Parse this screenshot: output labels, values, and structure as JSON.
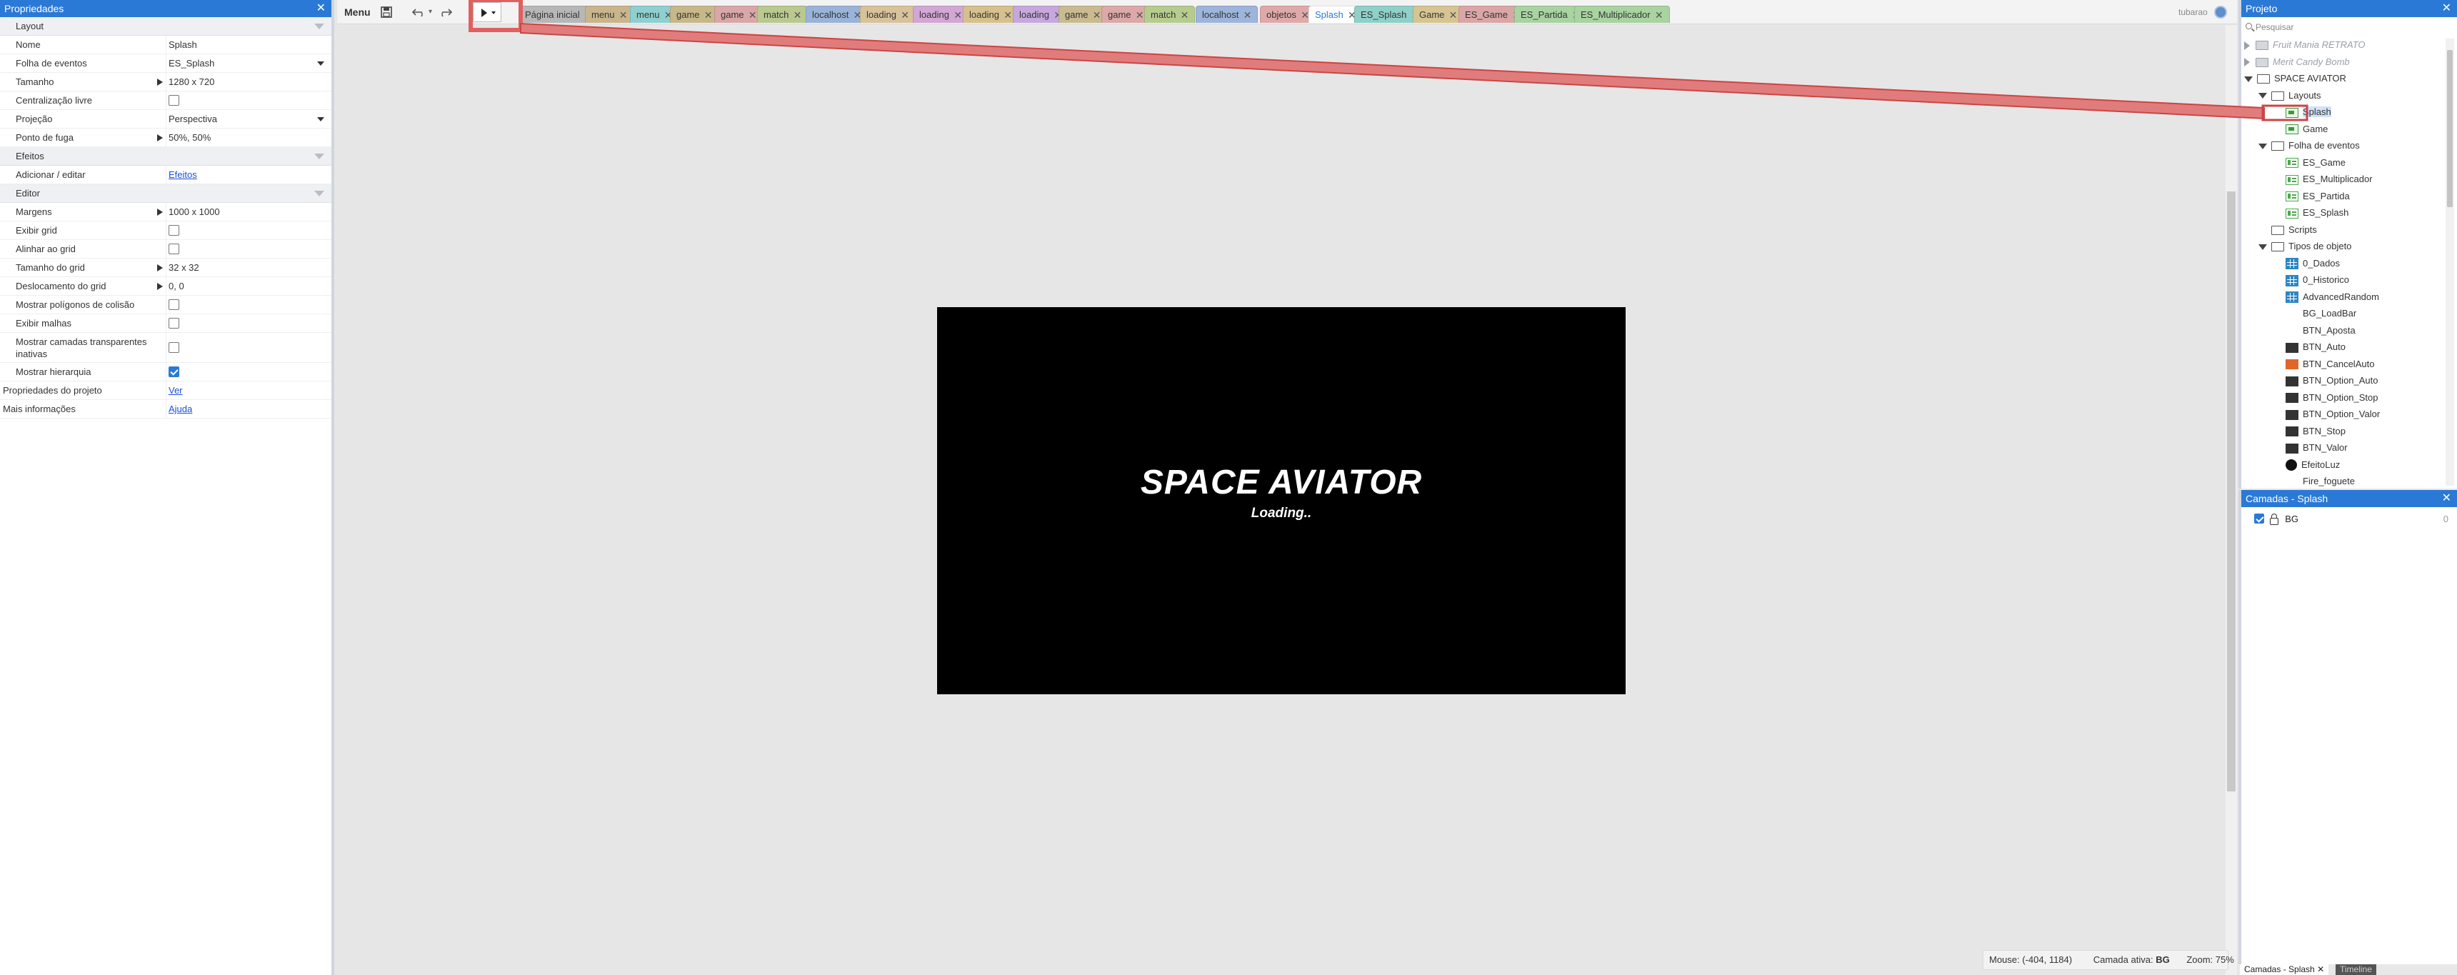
{
  "properties_panel": {
    "title": "Propriedades",
    "sections": {
      "layout": "Layout",
      "efeitos": "Efeitos",
      "editor": "Editor"
    },
    "rows": {
      "nome": {
        "label": "Nome",
        "value": "Splash"
      },
      "folha": {
        "label": "Folha de eventos",
        "value": "ES_Splash"
      },
      "tamanho": {
        "label": "Tamanho",
        "value": "1280 x 720"
      },
      "centralizacao": {
        "label": "Centralização livre",
        "checked": false
      },
      "projecao": {
        "label": "Projeção",
        "value": "Perspectiva"
      },
      "ponto": {
        "label": "Ponto de fuga",
        "value": "50%, 50%"
      },
      "adicionar": {
        "label": "Adicionar / editar",
        "value": "Efeitos"
      },
      "margens": {
        "label": "Margens",
        "value": "1000 x 1000"
      },
      "exibir_grid": {
        "label": "Exibir grid",
        "checked": false
      },
      "alinhar_grid": {
        "label": "Alinhar ao grid",
        "checked": false
      },
      "tamanho_grid": {
        "label": "Tamanho do grid",
        "value": "32 x 32"
      },
      "desloc_grid": {
        "label": "Deslocamento do grid",
        "value": "0, 0"
      },
      "poligonos": {
        "label": "Mostrar polígonos de colisão",
        "checked": false
      },
      "malhas": {
        "label": "Exibir malhas",
        "checked": false
      },
      "camadas_transp": {
        "label": "Mostrar camadas transparentes inativas",
        "checked": false
      },
      "hierarquia": {
        "label": "Mostrar hierarquia",
        "checked": true
      },
      "prop_projeto": {
        "label": "Propriedades do projeto",
        "value": "Ver"
      },
      "mais_info": {
        "label": "Mais informações",
        "value": "Ajuda"
      }
    }
  },
  "toolbar": {
    "menu_label": "Menu",
    "user": "tubarao",
    "tabs": [
      {
        "label": "Página inicial",
        "color": "#b7b7b7"
      },
      {
        "label": "menu",
        "color": "#c9b58c"
      },
      {
        "label": "menu",
        "color": "#8fcfd0"
      },
      {
        "label": "game",
        "color": "#c7b88a"
      },
      {
        "label": "game",
        "color": "#d9a7a7"
      },
      {
        "label": "match",
        "color": "#b9c98f"
      },
      {
        "label": "localhost",
        "color": "#9ab3d8"
      },
      {
        "label": "loading",
        "color": "#d8c29a"
      },
      {
        "label": "loading",
        "color": "#d3a6d6"
      },
      {
        "label": "loading",
        "color": "#d6c08c"
      },
      {
        "label": "loading",
        "color": "#c6a8de"
      },
      {
        "label": "game",
        "color": "#c9bb8f"
      },
      {
        "label": "game",
        "color": "#dca8a8"
      },
      {
        "label": "match",
        "color": "#b6cc8e"
      },
      {
        "label": "localhost",
        "color": "#9db5db"
      },
      {
        "label": "objetos",
        "color": "#e0a9a9"
      },
      {
        "label": "Splash",
        "color": "#ffffff",
        "active": true
      },
      {
        "label": "ES_Splash",
        "color": "#8fd0c9"
      },
      {
        "label": "Game",
        "color": "#d6c592"
      },
      {
        "label": "ES_Game",
        "color": "#dba6a6"
      },
      {
        "label": "ES_Partida",
        "color": "#a9d3a1"
      },
      {
        "label": "ES_Multiplicador",
        "color": "#a9d3a1"
      }
    ]
  },
  "canvas": {
    "game_title": "SPACE AVIATOR",
    "game_subtitle": "Loading..",
    "status_mouse": "Mouse: (-404, 1184)",
    "status_layer_label": "Camada ativa:",
    "status_layer_value": "BG",
    "status_zoom": "Zoom: 75%"
  },
  "project_panel": {
    "title": "Projeto",
    "search_placeholder": "Pesquisar",
    "items": [
      {
        "label": "Fruit Mania RETRATO",
        "icon": "folder-icon",
        "dim": true
      },
      {
        "label": "Merit Candy Bomb",
        "icon": "folder-icon",
        "dim": true
      },
      {
        "label": "SPACE AVIATOR",
        "icon": "folder-icon"
      },
      {
        "label": "Layouts",
        "icon": "folder-icon"
      },
      {
        "label": "Splash",
        "icon": "layout-icon"
      },
      {
        "label": "Game",
        "icon": "layout-icon"
      },
      {
        "label": "Folha de eventos",
        "icon": "folder-icon"
      },
      {
        "label": "ES_Game",
        "icon": "event-sheet-icon"
      },
      {
        "label": "ES_Multiplicador",
        "icon": "event-sheet-icon"
      },
      {
        "label": "ES_Partida",
        "icon": "event-sheet-icon"
      },
      {
        "label": "ES_Splash",
        "icon": "event-sheet-icon"
      },
      {
        "label": "Scripts",
        "icon": "folder-icon"
      },
      {
        "label": "Tipos de objeto",
        "icon": "folder-icon"
      },
      {
        "label": "0_Dados",
        "icon": "grid-icon"
      },
      {
        "label": "0_Historico",
        "icon": "grid-icon"
      },
      {
        "label": "AdvancedRandom",
        "icon": "grid-icon"
      },
      {
        "label": "BG_LoadBar",
        "icon": "blank-icon"
      },
      {
        "label": "BTN_Aposta",
        "icon": "blank-icon"
      },
      {
        "label": "BTN_Auto",
        "icon": "sprite-icon"
      },
      {
        "label": "BTN_CancelAuto",
        "icon": "sprite-orange-icon"
      },
      {
        "label": "BTN_Option_Auto",
        "icon": "sprite-icon"
      },
      {
        "label": "BTN_Option_Stop",
        "icon": "sprite-icon"
      },
      {
        "label": "BTN_Option_Valor",
        "icon": "sprite-icon"
      },
      {
        "label": "BTN_Stop",
        "icon": "sprite-icon"
      },
      {
        "label": "BTN_Valor",
        "icon": "sprite-icon"
      },
      {
        "label": "EfeitoLuz",
        "icon": "circle-icon"
      },
      {
        "label": "Fire_foguete",
        "icon": "blank-icon"
      }
    ]
  },
  "layers_panel": {
    "title": "Camadas - Splash",
    "layer_name": "BG",
    "layer_index": "0",
    "layer_visible": true
  },
  "bottom_tabs": {
    "tab1": "Camadas - Splash",
    "tab2": "Timeline"
  },
  "colors": {
    "accent": "#2b79d6",
    "annotation_red": "#e06060"
  }
}
